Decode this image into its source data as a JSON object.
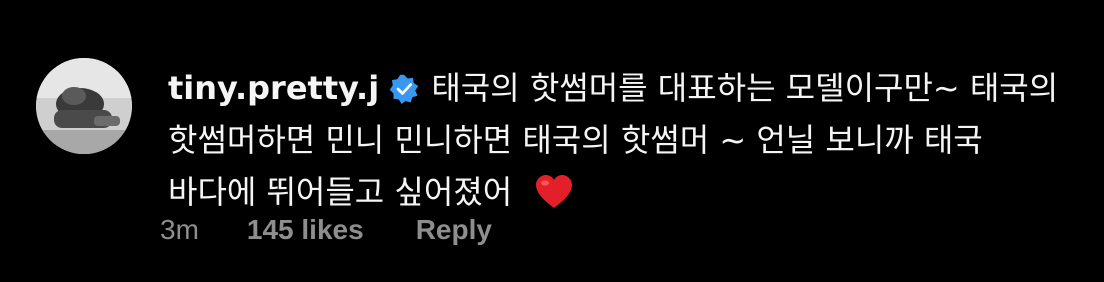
{
  "comment": {
    "avatar_icon": "profile-avatar",
    "username": "tiny.pretty.j",
    "verified_icon": "verified-badge-icon",
    "verified_color": "#3897f0",
    "text": "태국의 핫썸머를 대표하는 모델이구만~ 태국의 핫썸머하면 민니 민니하면 태국의 핫썸머 ~ 언닐 보니까 태국 바다에 뛰어들고 싶어졌어",
    "emoji_icon": "red-heart-emoji",
    "emoji_color": "#e3202a",
    "time": "3m",
    "likes": "145 likes",
    "reply_label": "Reply"
  },
  "colors": {
    "background": "#000000",
    "text": "#f5f5f5",
    "meta": "#8e8e8e"
  }
}
